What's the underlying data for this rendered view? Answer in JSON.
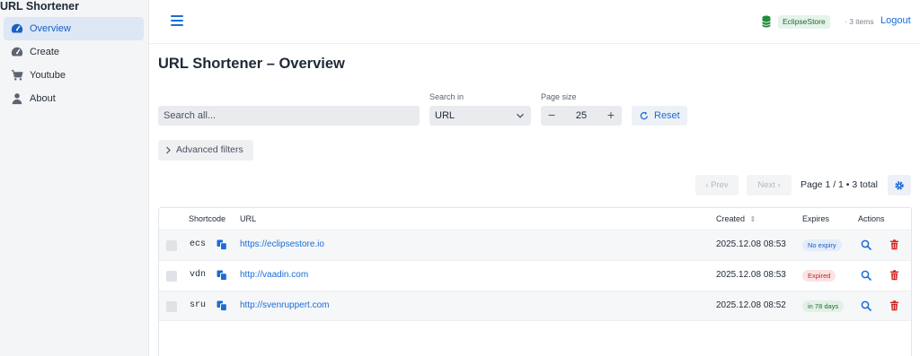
{
  "app": {
    "title": "URL Shortener"
  },
  "sidebar": {
    "items": [
      {
        "label": "Overview",
        "icon": "speedometer-icon"
      },
      {
        "label": "Create",
        "icon": "gauge-icon"
      },
      {
        "label": "Youtube",
        "icon": "cart-icon"
      },
      {
        "label": "About",
        "icon": "user-icon"
      }
    ]
  },
  "header": {
    "store_badge": "EclipseStore",
    "items_count": "· 3 items",
    "logout": "Logout"
  },
  "page": {
    "title": "URL Shortener – Overview"
  },
  "search": {
    "placeholder": "Search all..."
  },
  "search_in": {
    "label": "Search in",
    "value": "URL"
  },
  "page_size": {
    "label": "Page size",
    "value": "25",
    "minus": "−",
    "plus": "+"
  },
  "reset": {
    "label": "Reset"
  },
  "advanced_filters": {
    "label": "Advanced filters"
  },
  "pagination": {
    "prev": "‹ Prev",
    "next": "Next ›",
    "info": "Page 1 / 1 • 3 total"
  },
  "table": {
    "headers": {
      "shortcode": "Shortcode",
      "url": "URL",
      "created": "Created",
      "created_sort": "⇕",
      "expires": "Expires",
      "actions": "Actions"
    },
    "rows": [
      {
        "shortcode": "ecs",
        "url": "https://eclipsestore.io",
        "created": "2025.12.08 08:53",
        "expires": "No expiry",
        "status": "info"
      },
      {
        "shortcode": "vdn",
        "url": "http://vaadin.com",
        "created": "2025.12.08 08:53",
        "expires": "Expired",
        "status": "error"
      },
      {
        "shortcode": "sru",
        "url": "http://svenruppert.com",
        "created": "2025.12.08 08:52",
        "expires": "in 78 days",
        "status": "success"
      }
    ]
  },
  "colors": {
    "accent": "#1a6cd6",
    "danger": "#d42424",
    "badge_info_bg": "#e3ecfa",
    "badge_info_fg": "#1a5fc4",
    "badge_error_bg": "#fbe3e3",
    "badge_error_fg": "#c42727",
    "badge_success_bg": "#e2f1e6",
    "badge_success_fg": "#1e6b35"
  }
}
